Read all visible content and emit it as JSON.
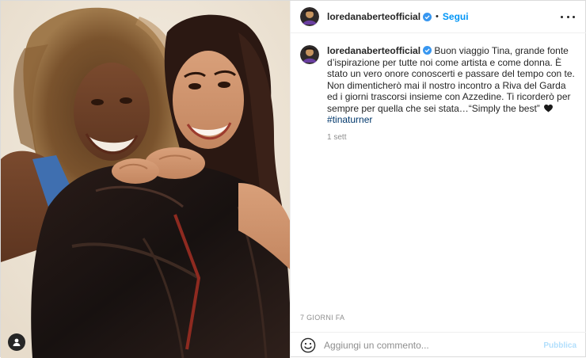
{
  "post": {
    "author": {
      "username": "loredanaberteofficial",
      "verified": true,
      "avatar_icon": "profile-avatar-icon"
    },
    "header": {
      "separator": "•",
      "follow_label": "Segui",
      "more_icon": "more-options-icon"
    },
    "caption": {
      "text_a": "Buon viaggio Tina, grande fonte d’ispirazione per tutte noi come artista e come donna. È stato un vero onore conoscerti e passare del tempo con te. Non dimenticherò mai il nostro incontro a Riva del Garda ed i giorni trascorsi insieme con Azzedine. Ti ricorderò per sempre per quella che sei stata…“Simply the best”",
      "emoji_icon": "black-heart-icon",
      "hashtag": "#tinaturner",
      "relative_time": "1 sett"
    },
    "date_label": "7 GIORNI FA",
    "comment": {
      "emoji_icon": "smiley-icon",
      "placeholder": "Aggiungi un commento...",
      "publish_label": "Pubblica"
    },
    "photo": {
      "tag_icon": "user-tag-icon"
    }
  },
  "colors": {
    "accent": "#0095f6",
    "hashtag": "#00376b",
    "muted": "#8e8e8e",
    "publish_disabled": "#b2dffc",
    "verified": "#3897f0"
  }
}
